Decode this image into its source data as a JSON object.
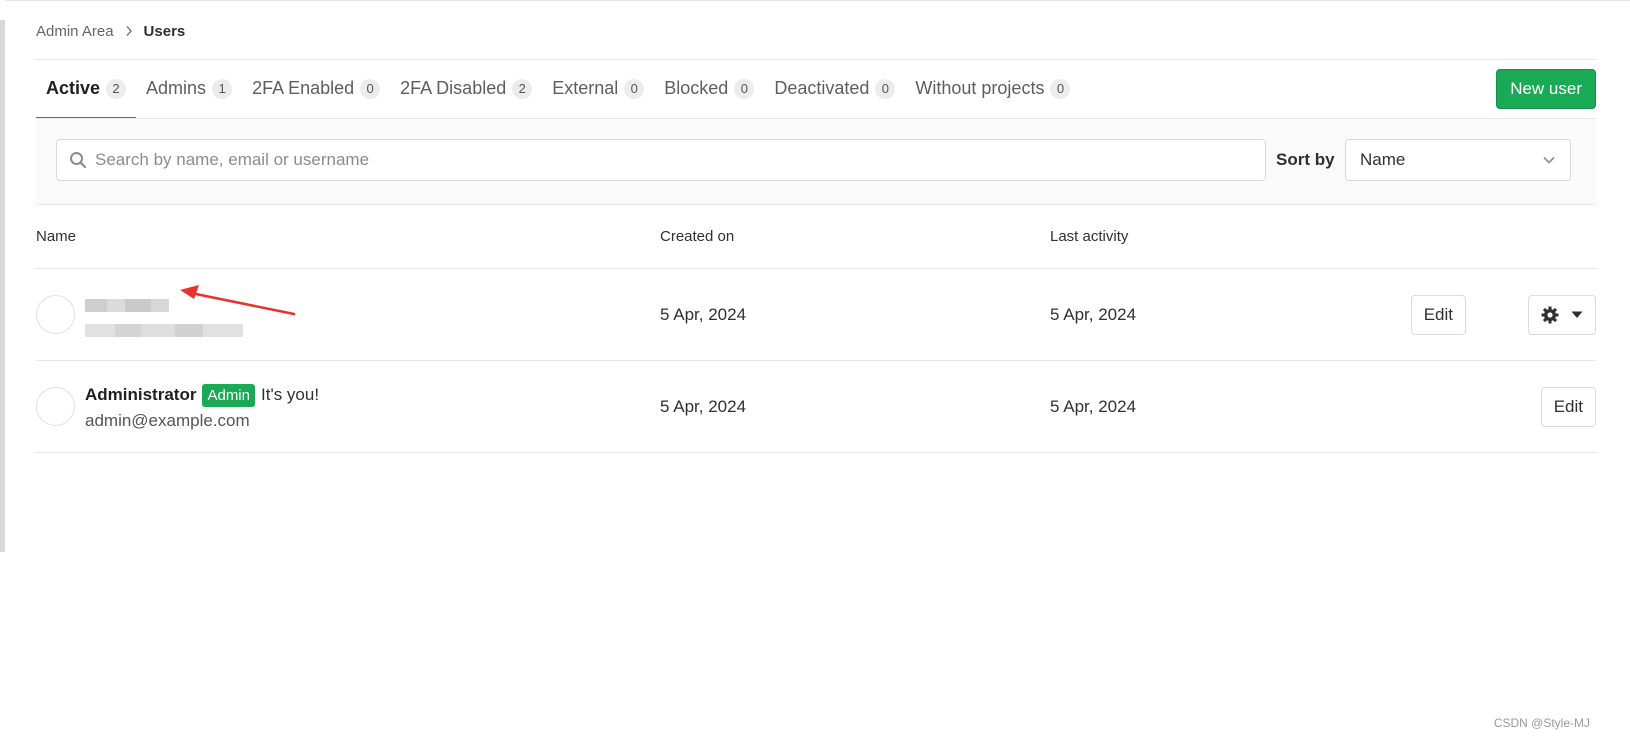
{
  "breadcrumb": {
    "parent": "Admin Area",
    "current": "Users"
  },
  "tabs": [
    {
      "label": "Active",
      "count": "2",
      "active": true
    },
    {
      "label": "Admins",
      "count": "1"
    },
    {
      "label": "2FA Enabled",
      "count": "0"
    },
    {
      "label": "2FA Disabled",
      "count": "2"
    },
    {
      "label": "External",
      "count": "0"
    },
    {
      "label": "Blocked",
      "count": "0"
    },
    {
      "label": "Deactivated",
      "count": "0"
    },
    {
      "label": "Without projects",
      "count": "0"
    }
  ],
  "actions": {
    "new_user_label": "New user"
  },
  "filter": {
    "search_placeholder": "Search by name, email or username",
    "sort_label": "Sort by",
    "sort_value": "Name"
  },
  "table": {
    "columns": [
      "Name",
      "Created on",
      "Last activity"
    ],
    "rows": [
      {
        "name": "",
        "email": "",
        "created_on": "5 Apr, 2024",
        "last_activity": "5 Apr, 2024",
        "edit_label": "Edit"
      },
      {
        "name": "Administrator",
        "badge": "Admin",
        "note": "It's you!",
        "email": "admin@example.com",
        "created_on": "5 Apr, 2024",
        "last_activity": "5 Apr, 2024",
        "edit_label": "Edit"
      }
    ]
  },
  "colors": {
    "accent_green": "#1aaa55",
    "tab_underline": "#6666c4",
    "annotation_arrow": "#e8322a"
  },
  "icons": [
    "chevron-right-icon",
    "search-icon",
    "chevron-down-icon",
    "gear-icon",
    "caret-down-icon",
    "arrow-annotation-icon"
  ],
  "watermark": "CSDN @Style-MJ"
}
